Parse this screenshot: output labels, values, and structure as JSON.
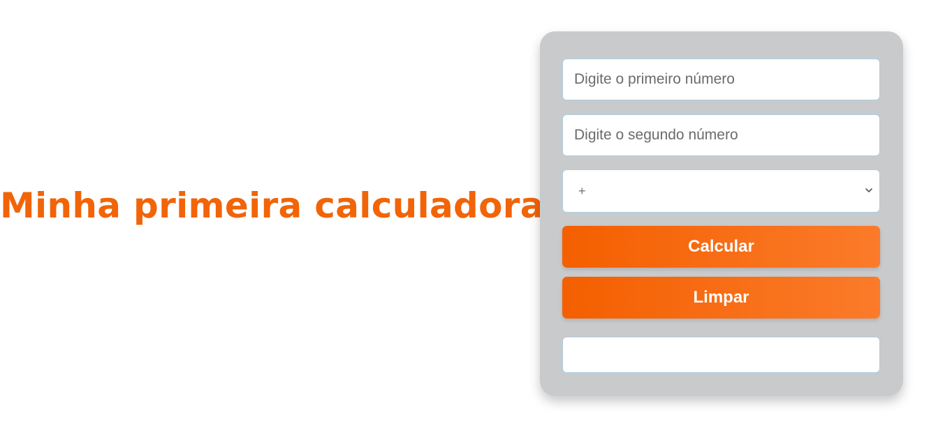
{
  "heading": {
    "title": "Minha primeira calculadora"
  },
  "calculator": {
    "first_number": {
      "value": "",
      "placeholder": "Digite o primeiro número"
    },
    "second_number": {
      "value": "",
      "placeholder": "Digite o segundo número"
    },
    "operation": {
      "selected": "+",
      "icon": "chevron-down-icon"
    },
    "calculate_label": "Calcular",
    "clear_label": "Limpar",
    "result": {
      "value": ""
    }
  },
  "colors": {
    "accent": "#f26408",
    "button_gradient_start": "#f45f00",
    "button_gradient_end": "#fb7b2a",
    "card_background": "#c9cacc",
    "field_border": "#a9cde2"
  }
}
